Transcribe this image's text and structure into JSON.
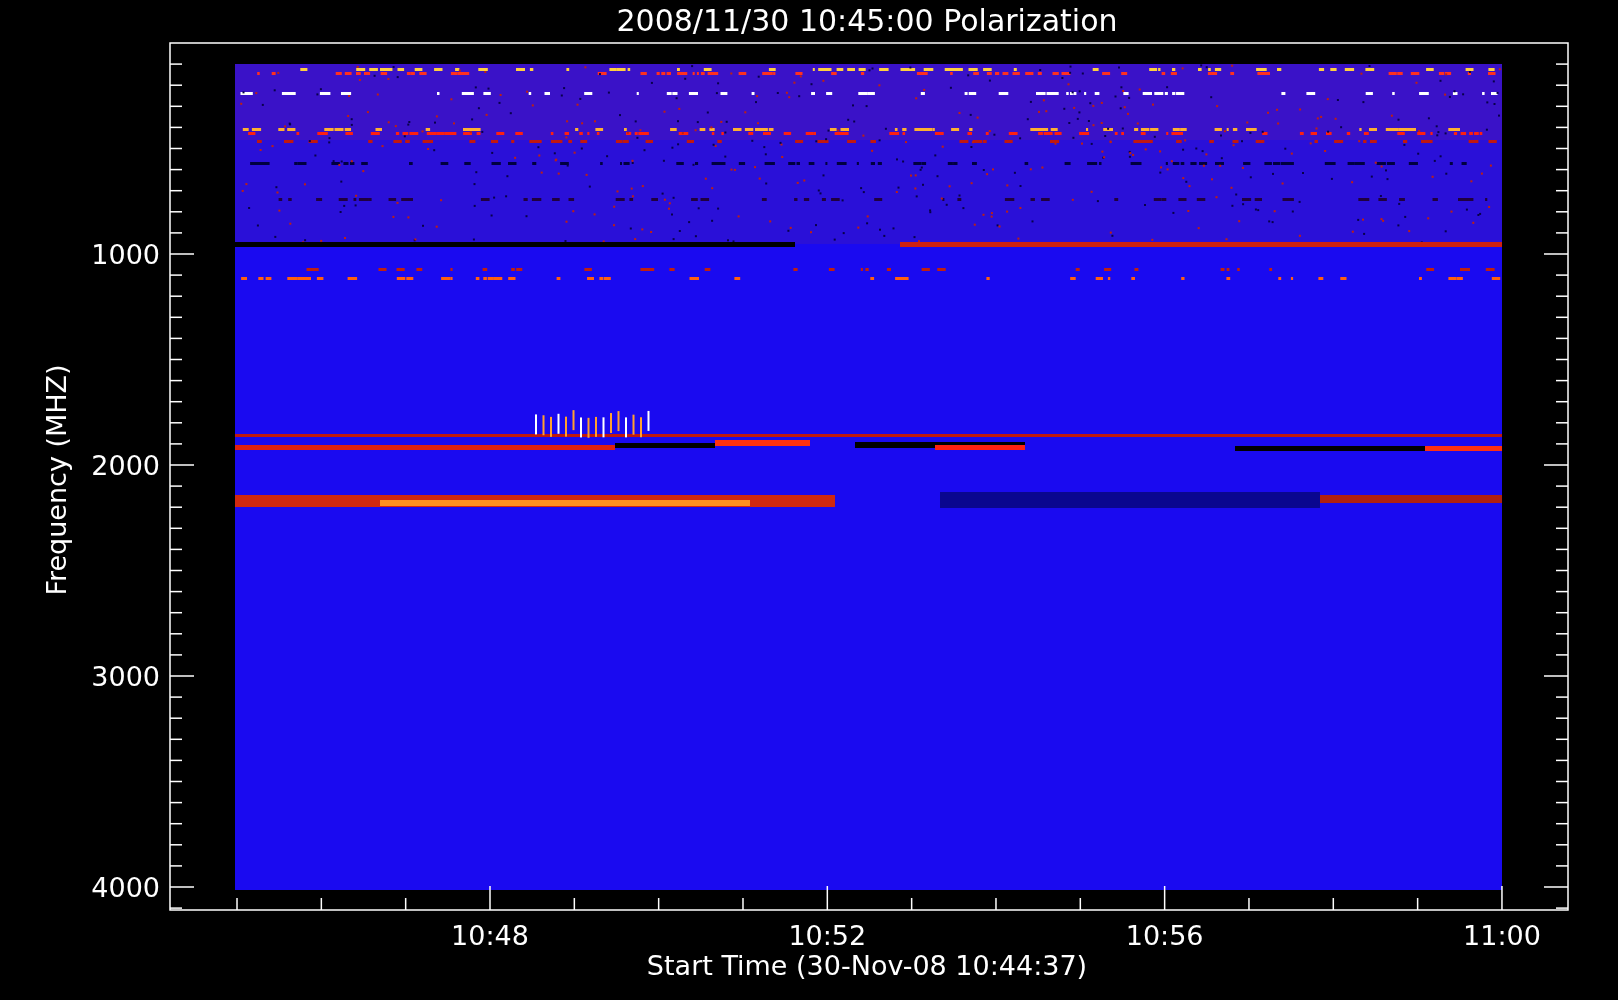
{
  "title": "2008/11/30 10:45:00 Polarization",
  "y_axis": {
    "label": "Frequency (MHZ)",
    "ticks": [
      "1000",
      "2000",
      "3000",
      "4000"
    ]
  },
  "x_axis": {
    "label": "Start Time (30-Nov-08 10:44:37)",
    "ticks": [
      "10:48",
      "10:52",
      "10:56",
      "11:00"
    ]
  }
}
